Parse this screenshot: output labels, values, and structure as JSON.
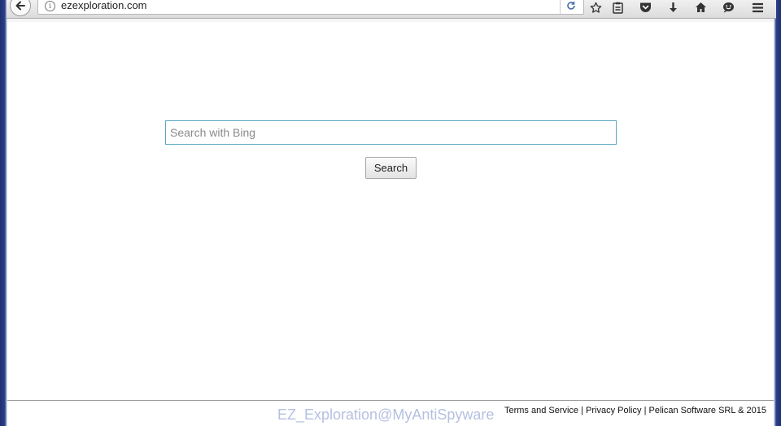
{
  "browser": {
    "url": "ezexploration.com",
    "icons": {
      "back": "back-arrow-icon",
      "info": "info-icon",
      "reload": "reload-icon",
      "bookmark": "star-icon",
      "reading_list": "clipboard-icon",
      "pocket": "pocket-icon",
      "downloads": "download-icon",
      "home": "home-icon",
      "hello": "chat-smiley-icon",
      "menu": "hamburger-menu-icon"
    }
  },
  "search": {
    "placeholder": "Search with Bing",
    "button_label": "Search"
  },
  "footer": {
    "terms": "Terms and Service",
    "separator": "|",
    "privacy": "Privacy Policy",
    "company": "Pelican Software SRL & 2015"
  },
  "watermark": "EZ_Exploration@MyAntiSpyware",
  "colors": {
    "desktop_blue": "#2b3f8c",
    "input_border": "#5ba8c4"
  }
}
